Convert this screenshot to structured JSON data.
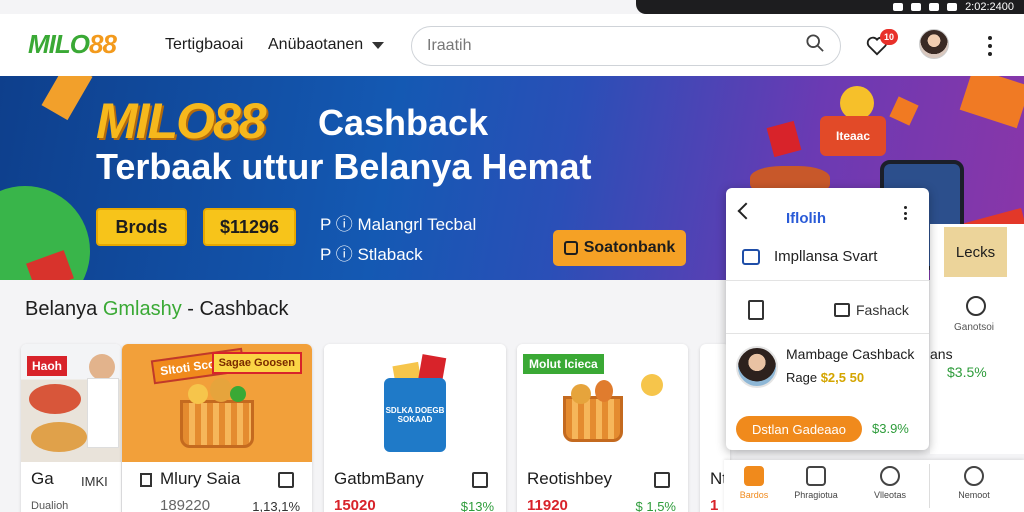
{
  "status_bar": {
    "time": "2:02:2400"
  },
  "header": {
    "logo_part1": "MILO",
    "logo_part2": "88",
    "nav": [
      "Tertigbaoai",
      "Anübaotanen"
    ],
    "search_value": "Iraatih",
    "badge_count": "10"
  },
  "banner": {
    "brand": "MILO88",
    "headline": "Cashback",
    "subheadline": "Terbaak uttur Belanya Hemat",
    "button_primary": "Brods",
    "button_price": "$11296",
    "line1": "P ⓘ Malangrl Tecbal",
    "line2": "P ⓘ Stlaback",
    "cta": "Soatonbank",
    "cart_label": "Iteaac"
  },
  "section": {
    "title_part1": "Belanya ",
    "title_green": "Gmlashy",
    "title_part2": " - Cashback"
  },
  "products": [
    {
      "tag": "Haoh",
      "title": "Ga",
      "extra": "IMKI",
      "sub": "Dualioh"
    },
    {
      "tag": "Sltoti Scoaag",
      "tag2": "Sagae Goosen",
      "title": "Mlury Saia",
      "price": "189220",
      "pct": "1,13,1%"
    },
    {
      "box": "SDLKA DOEGB SOKAAD",
      "title": "GatbmBany",
      "price": "15020",
      "pct": "$13%"
    },
    {
      "tag": "Molut Icieca",
      "title": "Reotishbey",
      "price": "11920",
      "pct": "$ 1,5%"
    },
    {
      "title": "Nt",
      "price": "1"
    }
  ],
  "popup": {
    "title": "Iflolih",
    "row1": "Impllansa Svart",
    "cash_link": "Fashack",
    "member_name": "Mambage Cashback",
    "member_rate_label": "Rage",
    "member_rate": "$2,5 50",
    "button": "Dstlan Gadeaao",
    "pct": "$3.9%"
  },
  "right_panel": {
    "tag": "Lecks",
    "icon_label": "Ganotsoi",
    "ans": "ans",
    "pct": "$3.5%"
  },
  "bottom_nav": [
    "Bardos",
    "Phragiotua",
    "Vlleotas",
    "Nemoot"
  ]
}
